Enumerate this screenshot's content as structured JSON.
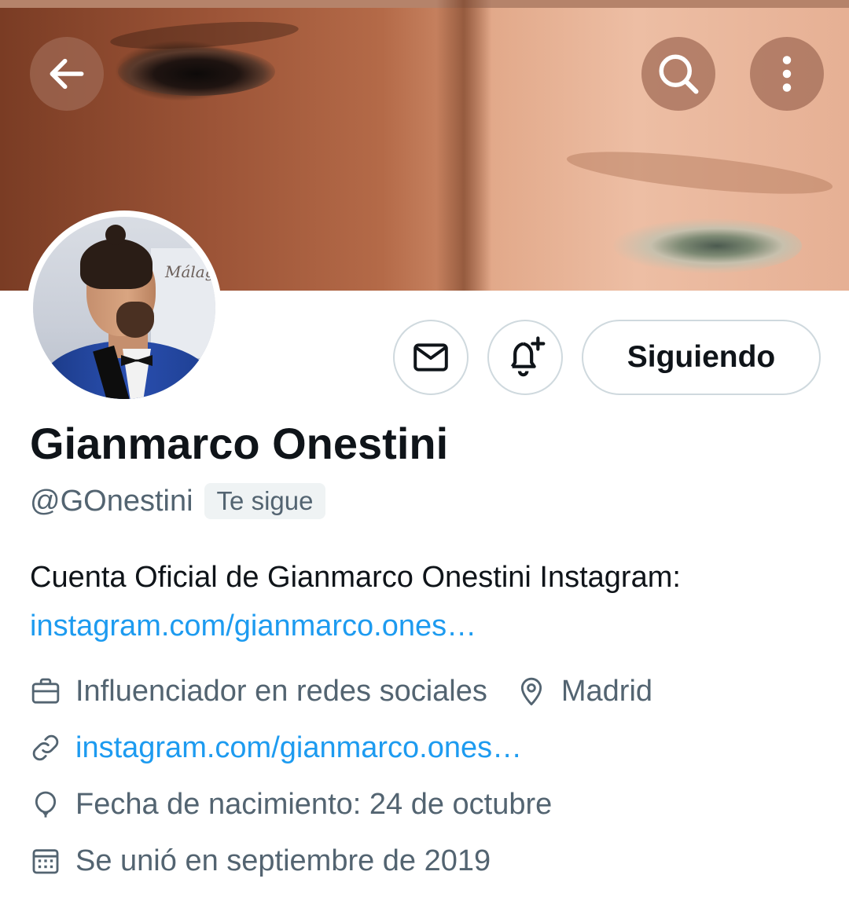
{
  "header": {
    "back_icon": "arrow-left-icon",
    "search_icon": "search-icon",
    "more_icon": "more-vertical-icon"
  },
  "actions": {
    "message_icon": "envelope-icon",
    "notify_icon": "bell-plus-icon",
    "follow_label": "Siguiendo"
  },
  "profile": {
    "name": "Gianmarco Onestini",
    "handle": "@GOnestini",
    "follows_you": "Te sigue",
    "bio_text": "Cuenta Oficial de Gianmarco Onestini Instagram:",
    "bio_link": "instagram.com/gianmarco.ones…"
  },
  "meta": {
    "profession": "Influenciador en redes sociales",
    "location": "Madrid",
    "website": "instagram.com/gianmarco.ones…",
    "birthday": "Fecha de nacimiento: 24 de octubre",
    "joined": "Se unió en septiembre de 2019"
  },
  "colors": {
    "link": "#1d9bf0",
    "secondary_text": "#536471",
    "primary_text": "#0f1419",
    "border": "#cfd9de"
  }
}
